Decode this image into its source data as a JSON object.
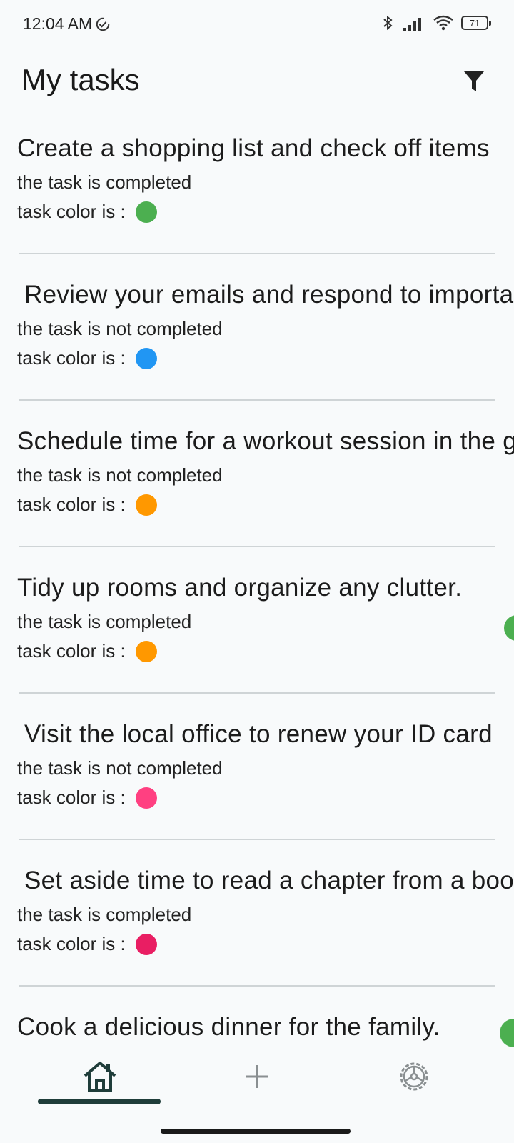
{
  "status_bar": {
    "time": "12:04 AM",
    "battery": "71"
  },
  "header": {
    "title": "My tasks"
  },
  "tasks": [
    {
      "title": "Create a shopping list and check off items",
      "status": "the task is completed",
      "color_label": "task color is :",
      "color": "#4caf50",
      "indent": false
    },
    {
      "title": "Review your emails and respond to important ones",
      "status": "the task is not completed",
      "color_label": "task color is :",
      "color": "#2196f3",
      "indent": true
    },
    {
      "title": "Schedule time for a workout session in the gym",
      "status": "the task is not completed",
      "color_label": "task color is :",
      "color": "#ff9800",
      "indent": false
    },
    {
      "title": "Tidy up rooms and organize any clutter.",
      "status": "the task is completed",
      "color_label": "task color is :",
      "color": "#ff9800",
      "indent": false
    },
    {
      "title": "Visit the local office to renew your ID card",
      "status": "the task is not completed",
      "color_label": "task color is :",
      "color": "#ff4081",
      "indent": true
    },
    {
      "title": "Set aside time to read a chapter from a book",
      "status": "the task is completed",
      "color_label": "task color is :",
      "color": "#e91e63",
      "indent": true
    },
    {
      "title": "Cook a delicious dinner for the family.",
      "status": "",
      "color_label": "",
      "color": "",
      "indent": false
    }
  ],
  "colors": {
    "accent": "#1f3d3a",
    "fab": "#4caf50"
  }
}
